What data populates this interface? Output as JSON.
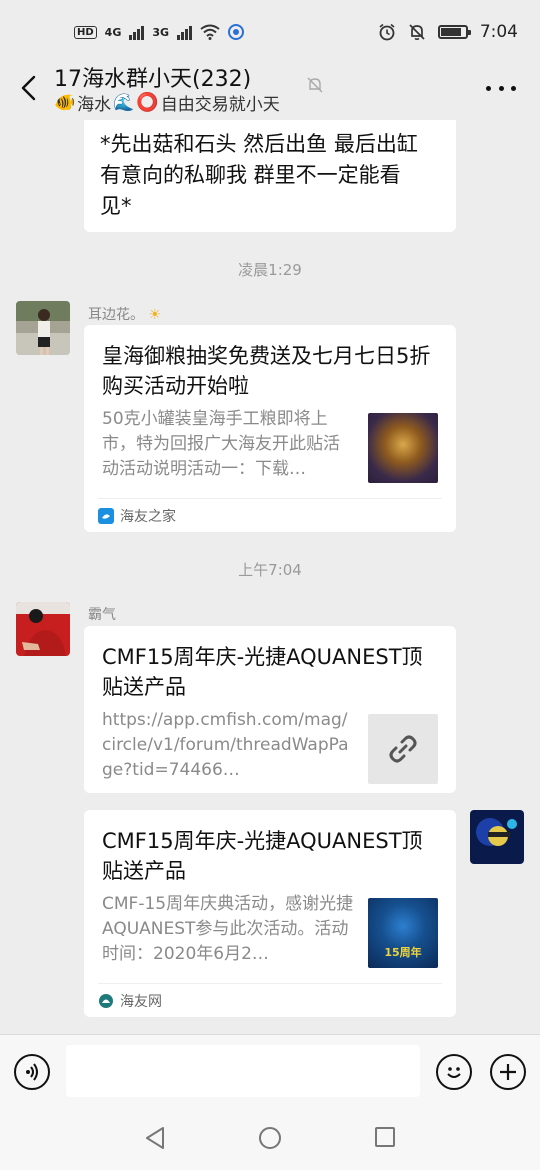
{
  "status_bar": {
    "network1": "4G",
    "network2": "3G",
    "time": "7:04",
    "battery_level": 0.85
  },
  "header": {
    "title": "17海水群小天(232)",
    "subtitle": "海水",
    "subtitle_suffix": "自由交易就小天",
    "icons": [
      "back-icon",
      "mute-icon",
      "more-icon"
    ]
  },
  "messages": {
    "text_message": {
      "line1": "*先出菇和石头 然后出鱼 最后出缸",
      "line2": "有意向的私聊我 群里不一定能看",
      "line3": "见*"
    },
    "timestamp1": "凌晨1:29",
    "msg1": {
      "sender": "耳边花。",
      "title": "皇海御粮抽奖免费送及七月七日5折购买活动开始啦",
      "desc": "50克小罐装皇海手工粮即将上市，特为回报广大海友开此贴活动活动说明活动一：下载…",
      "source": "海友之家"
    },
    "timestamp2": "上午7:04",
    "msg2": {
      "sender": "霸气",
      "title": "CMF15周年庆-光捷AQUANEST顶贴送产品",
      "desc": "https://app.cmfish.com/mag/circle/v1/forum/threadWapPage?tid=74466…"
    },
    "msg3": {
      "title": "CMF15周年庆-光捷AQUANEST顶贴送产品",
      "desc": "CMF-15周年庆典活动，感谢光捷AQUANEST参与此次活动。活动时间：2020年6月2…",
      "source": "海友网"
    }
  },
  "colors": {
    "background": "#ededed",
    "bubble": "#ffffff",
    "muted_text": "#8a8a8a"
  }
}
